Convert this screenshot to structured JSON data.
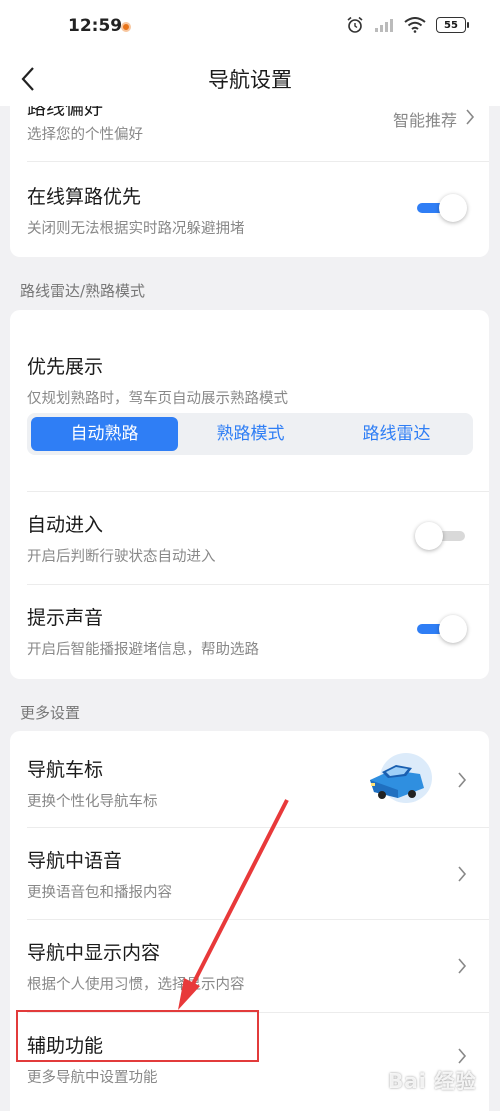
{
  "status": {
    "time": "12:59",
    "battery": "55"
  },
  "header": {
    "title": "导航设置"
  },
  "route_pref": {
    "title": "路线偏好",
    "subtitle": "选择您的个性偏好",
    "value": "智能推荐"
  },
  "online_calc": {
    "title": "在线算路优先",
    "subtitle": "关闭则无法根据实时路况躲避拥堵",
    "toggle": true
  },
  "radar_section": {
    "label": "路线雷达/熟路模式"
  },
  "priority": {
    "title": "优先展示",
    "subtitle": "仅规划熟路时，驾车页自动展示熟路模式",
    "options": [
      "自动熟路",
      "熟路模式",
      "路线雷达"
    ],
    "selected": "自动熟路"
  },
  "auto_enter": {
    "title": "自动进入",
    "subtitle": "开启后判断行驶状态自动进入",
    "toggle": false
  },
  "sound": {
    "title": "提示声音",
    "subtitle": "开启后智能播报避堵信息，帮助选路",
    "toggle": true
  },
  "more_section": {
    "label": "更多设置"
  },
  "more_items": [
    {
      "title": "导航车标",
      "subtitle": "更换个性化导航车标"
    },
    {
      "title": "导航中语音",
      "subtitle": "更换语音包和播报内容"
    },
    {
      "title": "导航中显示内容",
      "subtitle": "根据个人使用习惯，选择显示内容"
    },
    {
      "title": "辅助功能",
      "subtitle": "更多导航中设置功能"
    }
  ],
  "watermark": "Bai 经验",
  "colors": {
    "accent": "#2f7ef5",
    "highlight": "#e23b3b"
  }
}
